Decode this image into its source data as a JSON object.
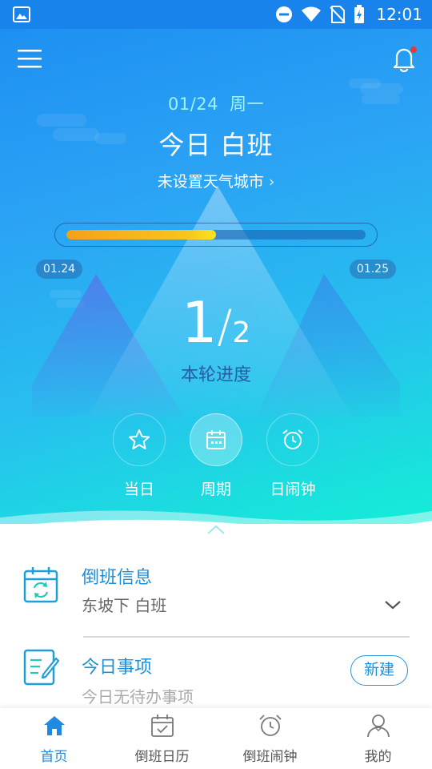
{
  "status_bar": {
    "time": "12:01"
  },
  "header": {
    "date": "01/24",
    "weekday": "周一",
    "shift_title": "今日 白班",
    "weather_link": "未设置天气城市"
  },
  "progress": {
    "fraction": 0.5,
    "start_date": "01.24",
    "end_date": "01.25"
  },
  "round": {
    "current": "1",
    "separator": "/",
    "total": "2",
    "label": "本轮进度"
  },
  "modes": [
    {
      "label": "当日",
      "icon": "star-icon"
    },
    {
      "label": "周期",
      "icon": "calendar-icon"
    },
    {
      "label": "日闹钟",
      "icon": "alarm-clock-icon"
    }
  ],
  "shift_info": {
    "title": "倒班信息",
    "value": "东坡下 白班"
  },
  "today_tasks": {
    "title": "今日事项",
    "empty_text": "今日无待办事项",
    "new_button": "新建"
  },
  "tabs": [
    {
      "label": "首页",
      "icon": "home-icon",
      "active": true
    },
    {
      "label": "倒班日历",
      "icon": "calendar-check-icon"
    },
    {
      "label": "倒班闹钟",
      "icon": "alarm-clock-icon"
    },
    {
      "label": "我的",
      "icon": "user-icon"
    }
  ],
  "colors": {
    "accent": "#1f8ae0",
    "hero_top": "#1c8df2",
    "hero_bottom": "#12f0d6",
    "progress_fill": "#f5a01a",
    "notification_dot": "#e53935"
  }
}
